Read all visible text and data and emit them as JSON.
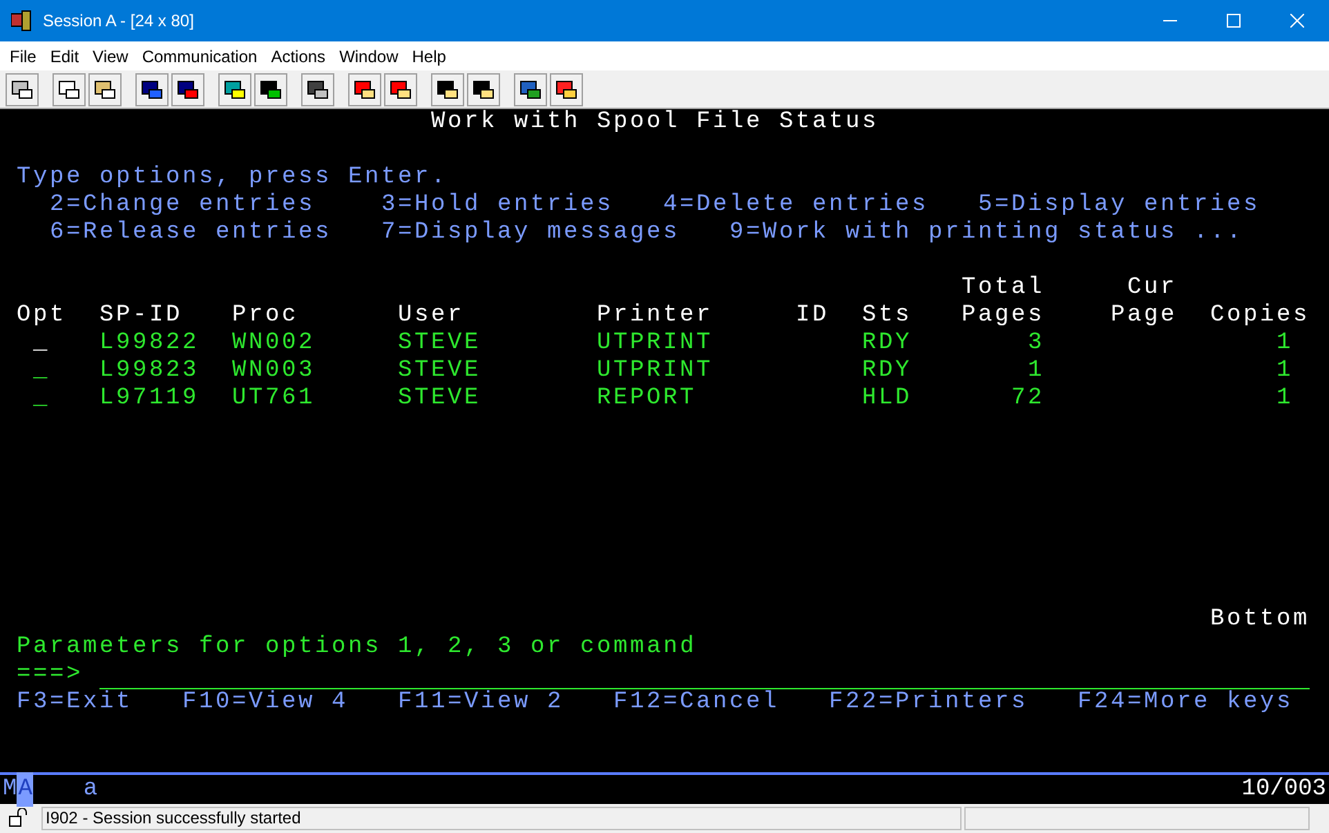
{
  "window": {
    "title": "Session A - [24 x 80]"
  },
  "menu": [
    {
      "label": "File"
    },
    {
      "label": "Edit"
    },
    {
      "label": "View"
    },
    {
      "label": "Communication"
    },
    {
      "label": "Actions"
    },
    {
      "label": "Window"
    },
    {
      "label": "Help"
    }
  ],
  "screen": {
    "title": "Work with Spool File Status",
    "instruction": "Type options, press Enter.",
    "option_lines": [
      [
        "2=Change entries",
        "3=Hold entries",
        "4=Delete entries",
        "5=Display entries"
      ],
      [
        "6=Release entries",
        "7=Display messages",
        "9=Work with printing status ..."
      ]
    ],
    "columns": [
      {
        "label": "Opt"
      },
      {
        "label": "SP-ID"
      },
      {
        "label": "Proc"
      },
      {
        "label": "User"
      },
      {
        "label": "Printer"
      },
      {
        "label": "ID"
      },
      {
        "label": "Sts"
      },
      {
        "top": "Total",
        "label": "Pages"
      },
      {
        "top": "Cur",
        "label": "Page"
      },
      {
        "label": "Copies"
      }
    ],
    "rows": [
      {
        "cursor": true,
        "cells": [
          "_",
          "L99822",
          "WN002",
          "STEVE",
          "UTPRINT",
          "",
          "RDY",
          "3",
          "",
          "1"
        ]
      },
      {
        "cursor": false,
        "cells": [
          "_",
          "L99823",
          "WN003",
          "STEVE",
          "UTPRINT",
          "",
          "RDY",
          "1",
          "",
          "1"
        ]
      },
      {
        "cursor": false,
        "cells": [
          "_",
          "L97119",
          "UT761",
          "STEVE",
          "REPORT",
          "",
          "HLD",
          "72",
          "",
          "1"
        ]
      }
    ],
    "more": "Bottom",
    "parameters": "Parameters for options 1, 2, 3 or command",
    "prompt": "===>",
    "fkeys": [
      "F3=Exit",
      "F10=View 4",
      "F11=View 2",
      "F12=Cancel",
      "F22=Printers",
      "F24=More keys"
    ]
  },
  "oia": {
    "system": "M",
    "inhibit": "A",
    "shift": "a",
    "position": "10/003"
  },
  "status": {
    "message": "I902 - Session successfully started"
  }
}
